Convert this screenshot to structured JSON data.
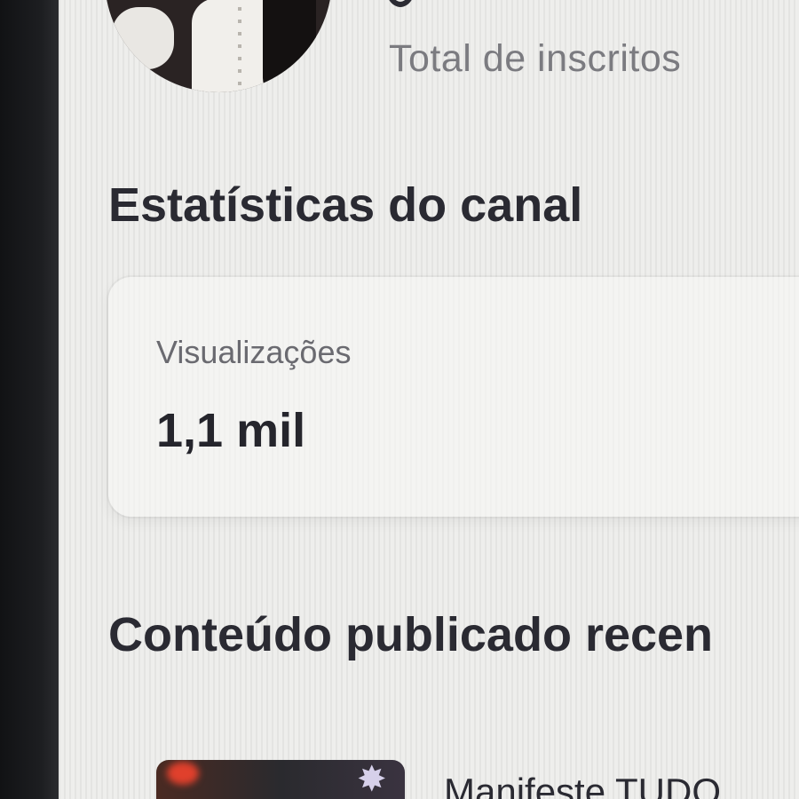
{
  "header": {
    "subscribers_label": "Total de inscritos"
  },
  "stats": {
    "title": "Estatísticas do canal",
    "views_label": "Visualizações",
    "views_value": "1,1 mil"
  },
  "recent": {
    "title": "Conteúdo publicado recen",
    "items": [
      {
        "title": "Manifeste TUDO",
        "thumbnail_icon": "video-thumbnail"
      }
    ]
  },
  "icons": {
    "avatar": "channel-avatar",
    "thumbnail_star": "sparkle-icon"
  }
}
